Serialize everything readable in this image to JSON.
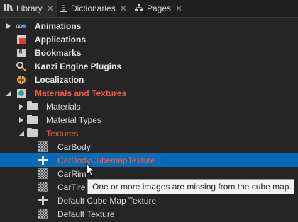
{
  "tabs": [
    {
      "label": "Library",
      "close": "✕"
    },
    {
      "label": "Dictionaries",
      "close": "✕"
    },
    {
      "label": "Pages",
      "close": "✕"
    }
  ],
  "tree": [
    {
      "label": "Animations",
      "icon": "animations-icon"
    },
    {
      "label": "Applications",
      "icon": "applications-icon"
    },
    {
      "label": "Bookmarks",
      "icon": "bookmarks-icon"
    },
    {
      "label": "Kanzi Engine Plugins",
      "icon": "plugins-icon"
    },
    {
      "label": "Localization",
      "icon": "localization-icon"
    },
    {
      "label": "Materials and Textures",
      "icon": "materials-textures-icon"
    },
    {
      "label": "Materials",
      "icon": "folder-icon"
    },
    {
      "label": "Material Types",
      "icon": "folder-icon"
    },
    {
      "label": "Textures",
      "icon": "folder-icon"
    },
    {
      "label": "CarBody",
      "icon": "texture-icon"
    },
    {
      "label": "CarBodyCubemapTexture",
      "icon": "cubemap-icon"
    },
    {
      "label": "CarRim",
      "icon": "texture-icon"
    },
    {
      "label": "CarTire",
      "icon": "texture-icon"
    },
    {
      "label": "Default Cube Map Texture",
      "icon": "cubemap-icon"
    },
    {
      "label": "Default Texture",
      "icon": "texture-icon"
    }
  ],
  "tooltip": "One or more images are missing from the cube map.",
  "colors": {
    "selected": "#0a6ab3",
    "error_text": "#f05a4a",
    "background": "#252525"
  }
}
